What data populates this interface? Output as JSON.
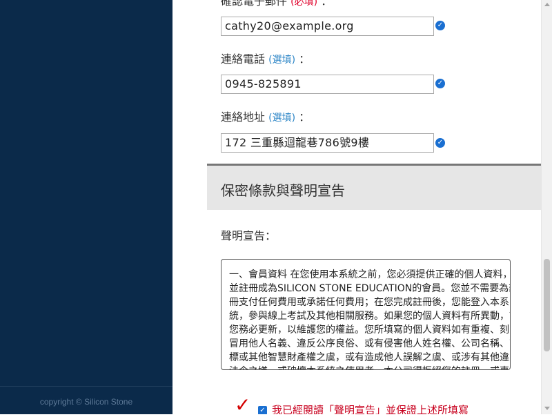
{
  "sidebar": {
    "footer": "copyright © Silicon Stone"
  },
  "form": {
    "email_label": "確認電子郵件",
    "email_tag": "(必填)",
    "email_colon": "：",
    "email_value": "cathy20@example.org",
    "phone_label": "連絡電話",
    "phone_tag": "(選填)",
    "phone_colon": "：",
    "phone_value": "0945-825891",
    "address_label": "連絡地址",
    "address_tag": "(選填)",
    "address_colon": "：",
    "address_value": "172 三重縣迴龍巷786號9樓",
    "valid_icon": "check-circle-icon"
  },
  "section": {
    "title": "保密條款與聲明宣告",
    "declaration_label": "聲明宣告：",
    "terms_text": "一、會員資料 在您使用本系統之前，您必須提供正確的個人資料，並註冊成為SILICON STONE EDUCATION的會員。您並不需要為註冊支付任何費用或承諾任何費用；在您完成註冊後，您能登入本系統，參與線上考試及其他相關服務。如果您的個人資料有所異動，請您務必更新，以維護您的權益。您所填寫的個人資料如有重複、刻意冒用他人名義、違反公序良俗、或有侵害他人姓名權、公司名稱、商標或其他智慧財產權之虞，或有造成他人誤解之虞、或涉有其他違反法令之嫌、或破壞本系統之使用者，本公司得拒絕您的註冊，或事後要求其更改，或取消"
  },
  "agreement": {
    "mark": "✓",
    "text": "我已經閱讀「聲明宣告」並保證上述所填寫"
  },
  "colors": {
    "sidebar_bg": "#0b2a4a",
    "optional_tag": "#2a84c6",
    "required_tag": "#e0002a",
    "check_blue": "#1a6fd1",
    "agree_red": "#c8001e"
  }
}
